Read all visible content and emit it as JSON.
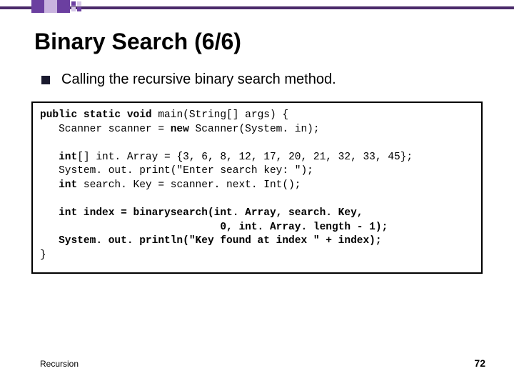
{
  "title": "Binary Search (6/6)",
  "bullet": "Calling the recursive binary search method.",
  "code": {
    "l1a": "public static void",
    "l1b": " main(String[] args) {",
    "l2a": "   Scanner scanner = ",
    "l2b": "new",
    "l2c": " Scanner(System. in);",
    "l3": "",
    "l4a": "   int",
    "l4b": "[] int. Array = {3, 6, 8, 12, 17, 20, 21, 32, 33, 45};",
    "l5": "   System. out. print(\"Enter search key: \");",
    "l6a": "   int",
    "l6b": " search. Key = scanner. next. Int();",
    "l7": "",
    "l8": "   int index = binarysearch(int. Array, search. Key,",
    "l9": "                             0, int. Array. length - 1);",
    "l10": "   System. out. println(\"Key found at index \" + index);",
    "l11": "}"
  },
  "footer_left": "Recursion",
  "footer_right": "72"
}
